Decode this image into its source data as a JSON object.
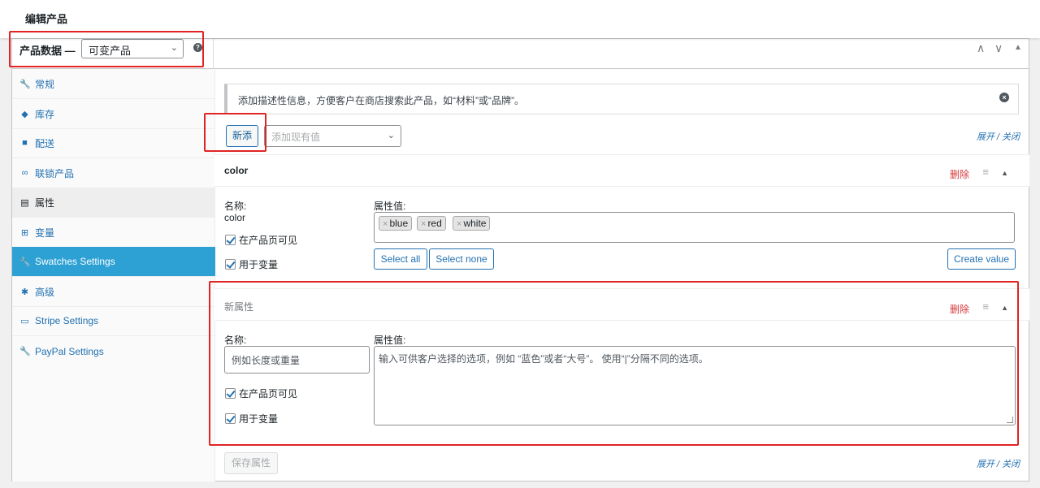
{
  "page": {
    "title": "编辑产品"
  },
  "panel": {
    "label": "产品数据 —",
    "product_type": "可变产品",
    "help_icon": "question-circle-icon",
    "controls": [
      "∧",
      "∨",
      "▲"
    ]
  },
  "sidebar": {
    "items": [
      {
        "icon": "wrench-icon",
        "glyph": "🔧",
        "label": "常规"
      },
      {
        "icon": "tag-icon",
        "glyph": "◆",
        "label": "库存"
      },
      {
        "icon": "truck-icon",
        "glyph": "■",
        "label": "配送"
      },
      {
        "icon": "link-icon",
        "glyph": "∞",
        "label": "联锁产品"
      },
      {
        "icon": "list-icon",
        "glyph": "▤",
        "label": "属性"
      },
      {
        "icon": "grid-icon",
        "glyph": "⊞",
        "label": "变量"
      },
      {
        "icon": "wrench-icon",
        "glyph": "🔧",
        "label": "Swatches Settings"
      },
      {
        "icon": "gear-icon",
        "glyph": "✱",
        "label": "高级"
      },
      {
        "icon": "card-icon",
        "glyph": "▭",
        "label": "Stripe Settings"
      },
      {
        "icon": "wrench-icon",
        "glyph": "🔧",
        "label": "PayPal Settings"
      }
    ]
  },
  "notice": {
    "text": "添加描述性信息，方便客户在商店搜索此产品，如“材料”或“品牌”。",
    "close": "×"
  },
  "toolbar": {
    "add_new_label": "新添",
    "existing_placeholder": "添加现有值",
    "expand": "展开",
    "separator": " / ",
    "collapse": "关闭"
  },
  "attributes": [
    {
      "title": "color",
      "remove": "删除",
      "name_label": "名称:",
      "name_value": "color",
      "values_label": "属性值:",
      "values": [
        "blue",
        "red",
        "white"
      ],
      "visible_label": "在产品页可见",
      "variation_label": "用于变量",
      "select_all": "Select all",
      "select_none": "Select none",
      "create_value": "Create value"
    },
    {
      "title": "新属性",
      "remove": "删除",
      "name_label": "名称:",
      "name_placeholder": "例如长度或重量",
      "values_label": "属性值:",
      "values_placeholder": "输入可供客户选择的选项，例如 “蓝色”或者“大号”。 使用“|”分隔不同的选项。",
      "visible_label": "在产品页可见",
      "variation_label": "用于变量"
    }
  ],
  "footer": {
    "save_label": "保存属性",
    "expand": "展开",
    "separator": " / ",
    "collapse": "关闭"
  }
}
